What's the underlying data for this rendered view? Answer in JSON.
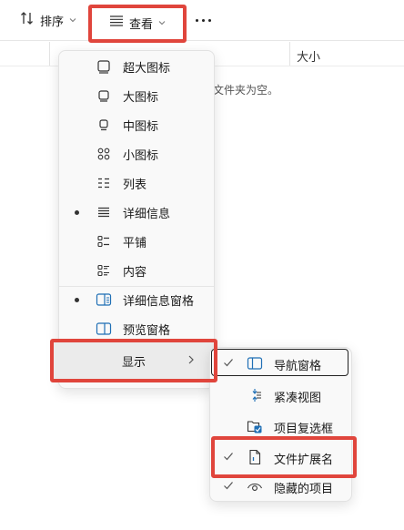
{
  "toolbar": {
    "sort_label": "排序",
    "view_label": "查看",
    "more_label": "更多选项"
  },
  "content": {
    "size_column": "大小",
    "empty_message": "文件夹为空。"
  },
  "view_menu": {
    "items": [
      {
        "label": "超大图标",
        "icon": "extra-large-icons-icon",
        "selected": false
      },
      {
        "label": "大图标",
        "icon": "large-icons-icon",
        "selected": false
      },
      {
        "label": "中图标",
        "icon": "medium-icons-icon",
        "selected": false
      },
      {
        "label": "小图标",
        "icon": "small-icons-icon",
        "selected": false
      },
      {
        "label": "列表",
        "icon": "list-icon",
        "selected": false
      },
      {
        "label": "详细信息",
        "icon": "details-icon",
        "selected": true
      },
      {
        "label": "平铺",
        "icon": "tiles-icon",
        "selected": false
      },
      {
        "label": "内容",
        "icon": "content-icon",
        "selected": false
      }
    ],
    "panes": [
      {
        "label": "详细信息窗格",
        "icon": "details-pane-icon",
        "selected": true
      },
      {
        "label": "预览窗格",
        "icon": "preview-pane-icon",
        "selected": false
      }
    ],
    "show_label": "显示"
  },
  "show_submenu": {
    "items": [
      {
        "label": "导航窗格",
        "icon": "navigation-pane-icon",
        "checked": true
      },
      {
        "label": "紧凑视图",
        "icon": "compact-view-icon",
        "checked": false
      },
      {
        "label": "项目复选框",
        "icon": "item-checkbox-icon",
        "checked": false
      },
      {
        "label": "文件扩展名",
        "icon": "file-extension-icon",
        "checked": true
      },
      {
        "label": "隐藏的项目",
        "icon": "hidden-items-icon",
        "checked": true
      }
    ]
  },
  "colors": {
    "highlight": "#e0453c",
    "accent": "#1f6fb5"
  }
}
